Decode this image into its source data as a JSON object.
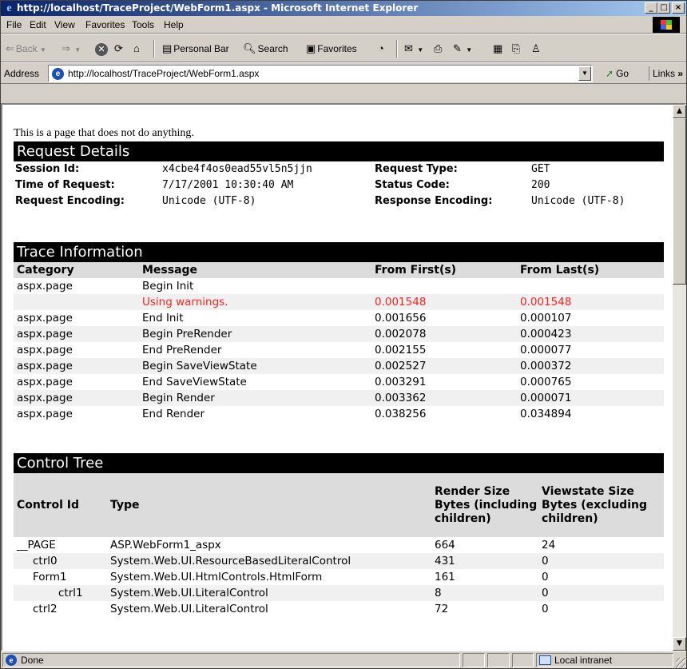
{
  "window": {
    "title": "http://localhost/TraceProject/WebForm1.aspx - Microsoft Internet Explorer",
    "buttons": {
      "minimize": "_",
      "maximize": "□",
      "close": "×"
    }
  },
  "menu": [
    "File",
    "Edit",
    "View",
    "Favorites",
    "Tools",
    "Help"
  ],
  "toolbar": {
    "back": "Back",
    "personal_bar": "Personal Bar",
    "search": "Search",
    "favorites": "Favorites"
  },
  "address": {
    "label": "Address",
    "url": "http://localhost/TraceProject/WebForm1.aspx",
    "go": "Go",
    "links": "Links"
  },
  "page": {
    "intro": "This is a page that does not do anything.",
    "request_details": {
      "heading": "Request Details",
      "session_id_label": "Session Id:",
      "session_id": "x4cbe4f4os0ead55vl5n5jjn",
      "time_label": "Time of Request:",
      "time": "7/17/2001 10:30:40 AM",
      "req_enc_label": "Request Encoding:",
      "req_enc": "Unicode (UTF-8)",
      "req_type_label": "Request Type:",
      "req_type": "GET",
      "status_label": "Status Code:",
      "status": "200",
      "resp_enc_label": "Response Encoding:",
      "resp_enc": "Unicode (UTF-8)"
    },
    "trace": {
      "heading": "Trace Information",
      "columns": [
        "Category",
        "Message",
        "From First(s)",
        "From Last(s)"
      ],
      "rows": [
        [
          "aspx.page",
          "Begin Init",
          "",
          ""
        ],
        [
          "",
          "Using warnings.",
          "0.001548",
          "0.001548"
        ],
        [
          "aspx.page",
          "End Init",
          "0.001656",
          "0.000107"
        ],
        [
          "aspx.page",
          "Begin PreRender",
          "0.002078",
          "0.000423"
        ],
        [
          "aspx.page",
          "End PreRender",
          "0.002155",
          "0.000077"
        ],
        [
          "aspx.page",
          "Begin SaveViewState",
          "0.002527",
          "0.000372"
        ],
        [
          "aspx.page",
          "End SaveViewState",
          "0.003291",
          "0.000765"
        ],
        [
          "aspx.page",
          "Begin Render",
          "0.003362",
          "0.000071"
        ],
        [
          "aspx.page",
          "End Render",
          "0.038256",
          "0.034894"
        ]
      ]
    },
    "control_tree": {
      "heading": "Control Tree",
      "columns": [
        "Control Id",
        "Type",
        "Render Size Bytes (including children)",
        "Viewstate Size Bytes (excluding children)"
      ],
      "rows": [
        [
          "__PAGE",
          "ASP.WebForm1_aspx",
          "664",
          "24"
        ],
        [
          "ctrl0",
          "System.Web.UI.ResourceBasedLiteralControl",
          "431",
          "0"
        ],
        [
          "Form1",
          "System.Web.UI.HtmlControls.HtmlForm",
          "161",
          "0"
        ],
        [
          "ctrl1",
          "System.Web.UI.LiteralControl",
          "8",
          "0"
        ],
        [
          "ctrl2",
          "System.Web.UI.LiteralControl",
          "72",
          "0"
        ]
      ]
    }
  },
  "status": {
    "text": "Done",
    "zone": "Local intranet"
  },
  "colors": {
    "warning": "#ff2020",
    "title_bar": "#0a246a",
    "section_heading": "#000000"
  }
}
